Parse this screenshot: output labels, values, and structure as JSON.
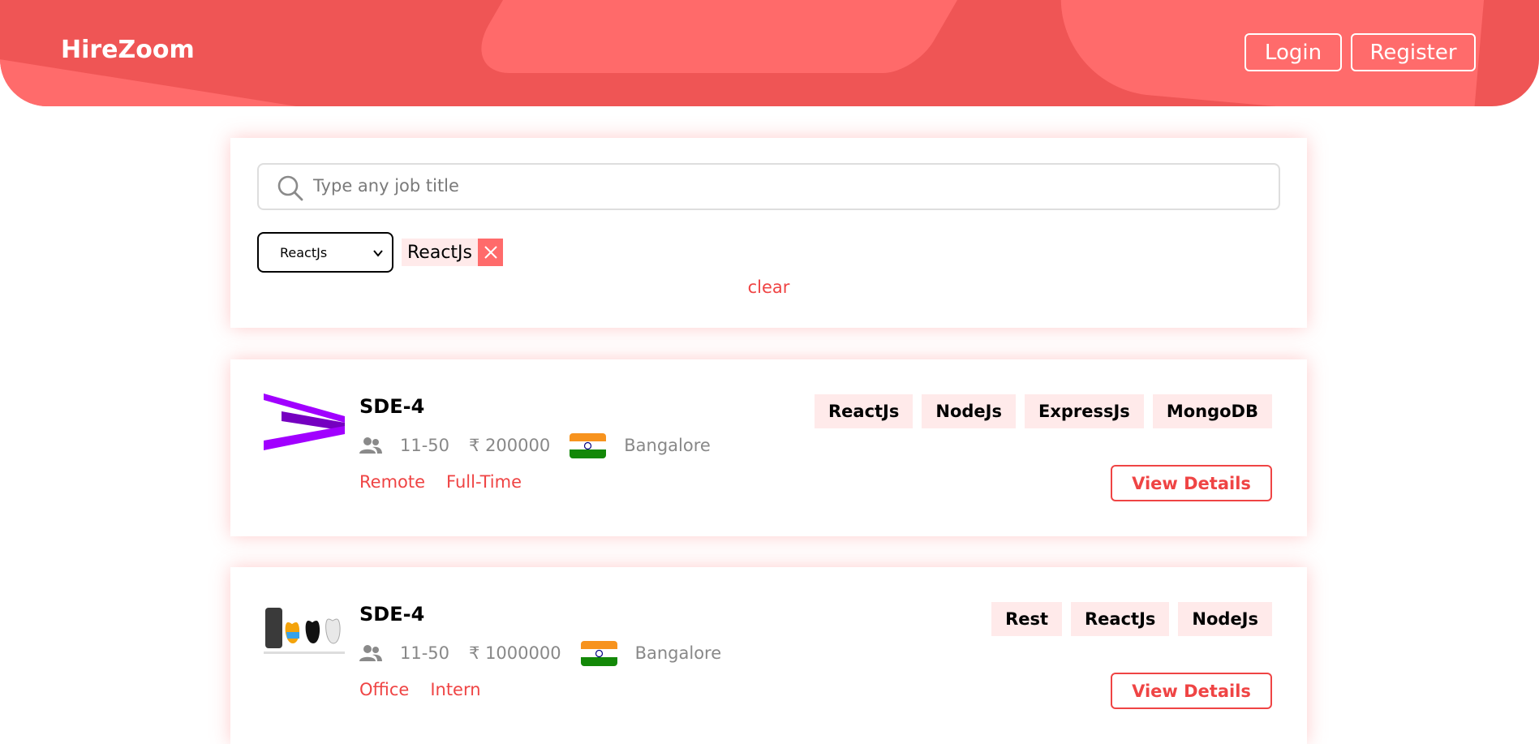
{
  "header": {
    "brand": "HireZoom",
    "login_label": "Login",
    "register_label": "Register",
    "colors": {
      "primary": "#ef5555",
      "accent": "#ff6b6b"
    }
  },
  "filters": {
    "search": {
      "placeholder": "Type any job title",
      "value": ""
    },
    "skill_select": {
      "selected": "ReactJs"
    },
    "active_chips": [
      {
        "label": "ReactJs"
      }
    ],
    "clear_label": "clear"
  },
  "jobs": [
    {
      "title": "SDE-4",
      "company_size": "11-50",
      "salary": "₹ 200000",
      "country_flag": "india-flag",
      "location": "Bangalore",
      "work_mode": "Remote",
      "job_type": "Full-Time",
      "skills": [
        "ReactJs",
        "NodeJs",
        "ExpressJs",
        "MongoDB"
      ],
      "action_label": "View Details",
      "logo": "accenture-logo"
    },
    {
      "title": "SDE-4",
      "company_size": "11-50",
      "salary": "₹ 1000000",
      "country_flag": "india-flag",
      "location": "Bangalore",
      "work_mode": "Office",
      "job_type": "Intern",
      "skills": [
        "Rest",
        "ReactJs",
        "NodeJs"
      ],
      "action_label": "View Details",
      "logo": "apple-evolution-logo"
    }
  ]
}
